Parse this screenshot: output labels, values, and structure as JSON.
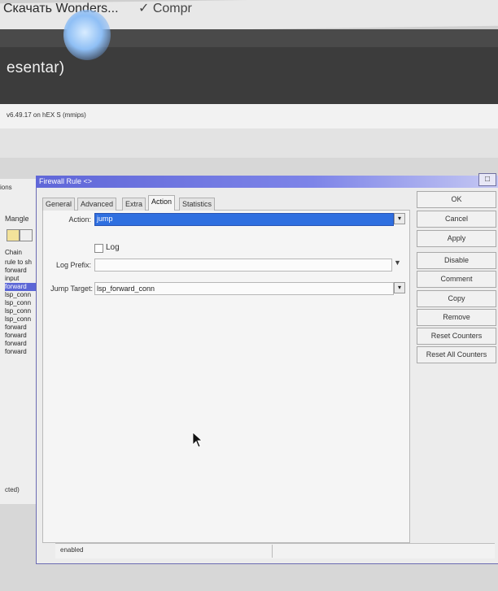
{
  "browser": {
    "tab_text": "Скачать Wonders...",
    "tab_extra": "✓ Compr"
  },
  "page": {
    "title": "esentar)",
    "version": "v6.49.17 on hEX S (mmips)"
  },
  "background_window": {
    "tab": "ions",
    "mangle_label": "Mangle",
    "list_header": "Chain",
    "rows": [
      {
        "text": "rule to sh",
        "selected": false
      },
      {
        "text": "forward",
        "selected": false
      },
      {
        "text": "input",
        "selected": false
      },
      {
        "text": "forward",
        "selected": true
      },
      {
        "text": "lsp_conn",
        "selected": false
      },
      {
        "text": "lsp_conn",
        "selected": false
      },
      {
        "text": "lsp_conn",
        "selected": false
      },
      {
        "text": "lsp_conn",
        "selected": false
      },
      {
        "text": "forward",
        "selected": false
      },
      {
        "text": "forward",
        "selected": false
      },
      {
        "text": "forward",
        "selected": false
      },
      {
        "text": "forward",
        "selected": false
      }
    ],
    "status": "cted)"
  },
  "firewall_rule": {
    "title": "Firewall Rule <>",
    "tabs": [
      "General",
      "Advanced",
      "Extra",
      "Action",
      "Statistics"
    ],
    "active_tab": "Action",
    "action_label": "Action:",
    "action_value": "jump",
    "log_label": "Log",
    "log_prefix_label": "Log Prefix:",
    "jump_target_label": "Jump Target:",
    "jump_target_value": "lsp_forward_conn",
    "buttons": [
      "OK",
      "Cancel",
      "Apply",
      "Disable",
      "Comment",
      "Copy",
      "Remove",
      "Reset Counters",
      "Reset All Counters"
    ],
    "status": "enabled"
  }
}
